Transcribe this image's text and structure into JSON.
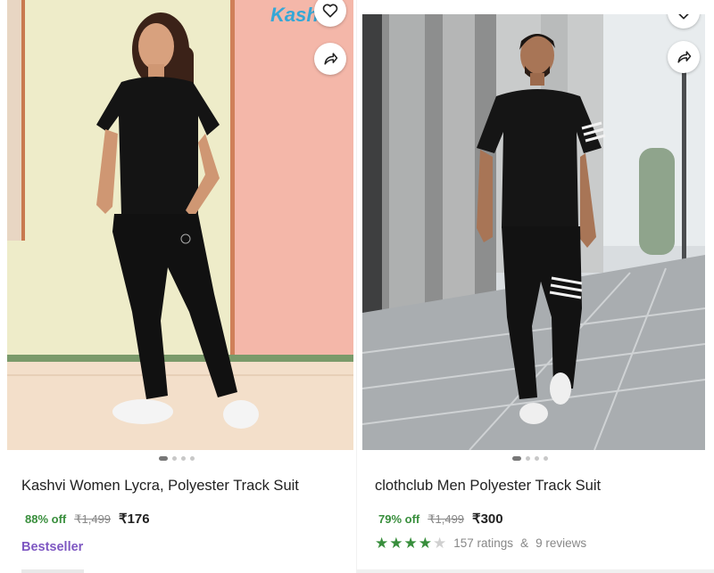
{
  "products": [
    {
      "name": "Kashvi Women Lycra, Polyester Track Suit",
      "discount": "88% off",
      "mrp": "₹1,499",
      "price": "₹176",
      "badge": "Bestseller",
      "brand_watermark": "Kashvi",
      "image_dots": 4,
      "active_dot": 0
    },
    {
      "name": "clothclub Men Polyester Track Suit",
      "discount": "79% off",
      "mrp": "₹1,499",
      "price": "₹300",
      "rating_stars": 4,
      "rating_count": "157 ratings",
      "reviews_sep": "&",
      "review_count": "9 reviews",
      "image_dots": 4,
      "active_dot": 0
    }
  ],
  "colors": {
    "discount": "#388e3c",
    "rating_star": "#388e3c",
    "badge": "#7e57c2",
    "mrp": "#878787"
  },
  "icons": {
    "wishlist": "heart-icon",
    "share": "share-icon"
  }
}
